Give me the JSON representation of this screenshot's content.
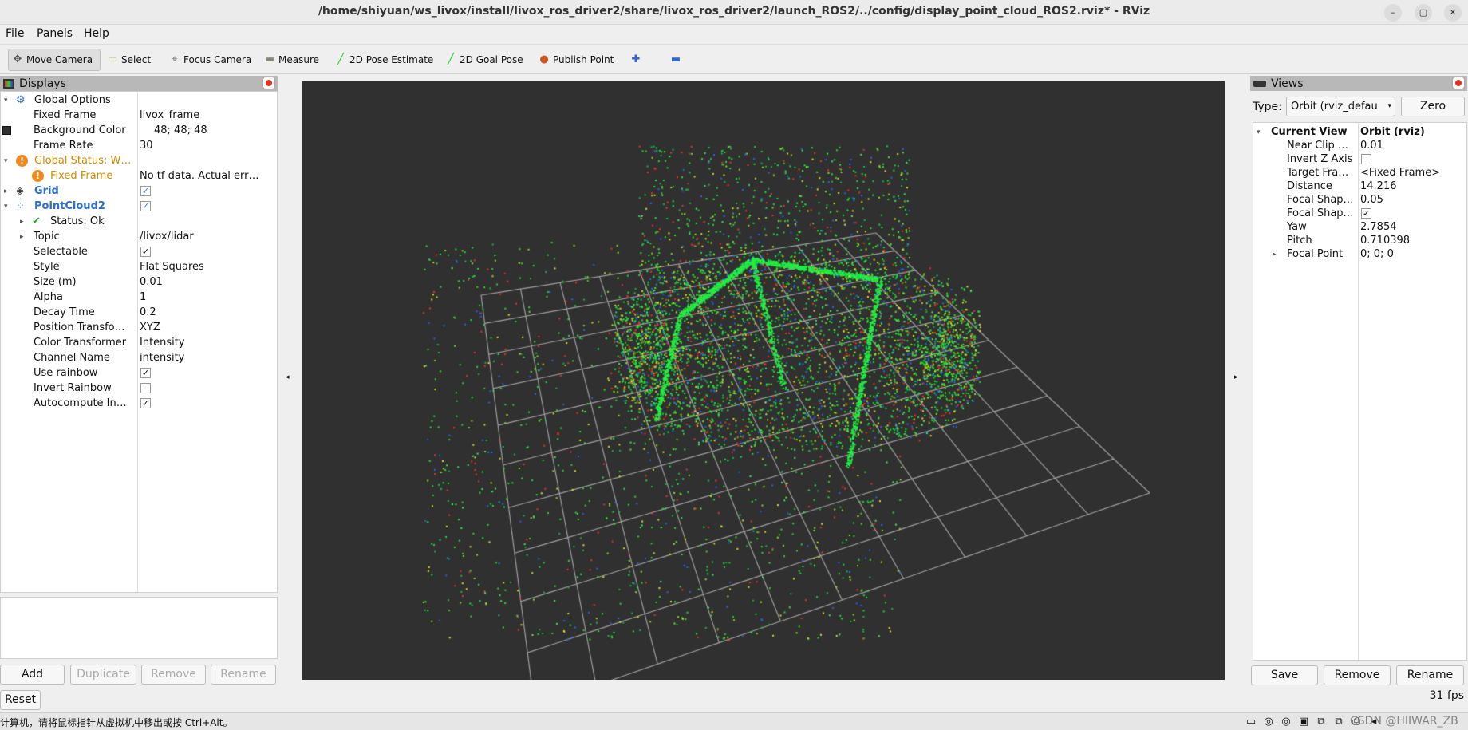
{
  "window": {
    "title": "/home/shiyuan/ws_livox/install/livox_ros_driver2/share/livox_ros_driver2/launch_ROS2/../config/display_point_cloud_ROS2.rviz* - RViz",
    "min": "–",
    "max": "▢",
    "close": "✕"
  },
  "menu": [
    "File",
    "Panels",
    "Help"
  ],
  "toolbar": [
    {
      "label": "Move Camera",
      "icon": "move-camera-icon",
      "glyph": "✥",
      "active": true
    },
    {
      "label": "Select",
      "icon": "select-icon",
      "glyph": "▭"
    },
    {
      "label": "Focus Camera",
      "icon": "focus-camera-icon",
      "glyph": "⌖"
    },
    {
      "label": "Measure",
      "icon": "ruler-icon",
      "glyph": "▬"
    },
    {
      "label": "2D Pose Estimate",
      "icon": "pose-arrow-icon",
      "glyph": "╱"
    },
    {
      "label": "2D Goal Pose",
      "icon": "goal-arrow-icon",
      "glyph": "╱"
    },
    {
      "label": "Publish Point",
      "icon": "map-pin-icon",
      "glyph": "●"
    },
    {
      "label": "",
      "icon": "plus-icon",
      "glyph": "✚"
    },
    {
      "label": "",
      "icon": "minus-icon",
      "glyph": "▬"
    }
  ],
  "displays": {
    "title": "Displays",
    "rows": [
      {
        "indent": 0,
        "exp": "▾",
        "icon": "gear-icon",
        "glyph": "⚙",
        "label": "Global Options",
        "value": ""
      },
      {
        "indent": 1,
        "label": "Fixed Frame",
        "value": "livox_frame"
      },
      {
        "indent": 1,
        "label": "Background Color",
        "value": "48; 48; 48",
        "swatch": "#303030"
      },
      {
        "indent": 1,
        "label": "Frame Rate",
        "value": "30"
      },
      {
        "indent": 0,
        "exp": "▾",
        "icon": "warning-icon",
        "glyph": "!",
        "label": "Global Status: W…",
        "value": "",
        "color": "#d08a00"
      },
      {
        "indent": 1,
        "icon": "warning-icon",
        "glyph": "!",
        "label": "Fixed Frame",
        "value": "No tf data.  Actual err…",
        "color": "#d08a00"
      },
      {
        "indent": 0,
        "exp": "▸",
        "icon": "grid-icon",
        "glyph": "◈",
        "label": "Grid",
        "check": true,
        "blue": true,
        "color": "#2a6fd0",
        "bold": true
      },
      {
        "indent": 0,
        "exp": "▾",
        "icon": "pointcloud-icon",
        "glyph": "⁘",
        "label": "PointCloud2",
        "check": true,
        "blue": true,
        "color": "#2a6fd0",
        "bold": true
      },
      {
        "indent": 1,
        "exp": "▸",
        "icon": "check-icon",
        "glyph": "✔",
        "label": "Status: Ok",
        "value": ""
      },
      {
        "indent": 1,
        "exp": "▸",
        "label": "Topic",
        "value": "/livox/lidar"
      },
      {
        "indent": 1,
        "label": "Selectable",
        "check": true
      },
      {
        "indent": 1,
        "label": "Style",
        "value": "Flat Squares"
      },
      {
        "indent": 1,
        "label": "Size (m)",
        "value": "0.01"
      },
      {
        "indent": 1,
        "label": "Alpha",
        "value": "1"
      },
      {
        "indent": 1,
        "label": "Decay Time",
        "value": "0.2"
      },
      {
        "indent": 1,
        "label": "Position Transfo…",
        "value": "XYZ"
      },
      {
        "indent": 1,
        "label": "Color Transformer",
        "value": "Intensity"
      },
      {
        "indent": 1,
        "label": "Channel Name",
        "value": "intensity"
      },
      {
        "indent": 1,
        "label": "Use rainbow",
        "check": true
      },
      {
        "indent": 1,
        "label": "Invert Rainbow",
        "check": false
      },
      {
        "indent": 1,
        "label": "Autocompute In…",
        "check": true
      }
    ],
    "buttons": {
      "add": "Add",
      "duplicate": "Duplicate",
      "remove": "Remove",
      "rename": "Rename",
      "reset": "Reset"
    }
  },
  "views": {
    "title": "Views",
    "type_label": "Type:",
    "type_value": "Orbit (rviz_defau",
    "zero": "Zero",
    "rows": [
      {
        "indent": 0,
        "exp": "▾",
        "label": "Current View",
        "value": "Orbit (rviz)",
        "bold": true
      },
      {
        "indent": 1,
        "label": "Near Clip …",
        "value": "0.01"
      },
      {
        "indent": 1,
        "label": "Invert Z Axis",
        "check": false
      },
      {
        "indent": 1,
        "label": "Target Fra…",
        "value": "<Fixed Frame>"
      },
      {
        "indent": 1,
        "label": "Distance",
        "value": "14.216"
      },
      {
        "indent": 1,
        "label": "Focal Shap…",
        "value": "0.05"
      },
      {
        "indent": 1,
        "label": "Focal Shap…",
        "check": true
      },
      {
        "indent": 1,
        "label": "Yaw",
        "value": "2.7854"
      },
      {
        "indent": 1,
        "label": "Pitch",
        "value": "0.710398"
      },
      {
        "indent": 1,
        "exp": "▸",
        "label": "Focal Point",
        "value": "0; 0; 0"
      }
    ],
    "buttons": {
      "save": "Save",
      "remove": "Remove",
      "rename": "Rename"
    },
    "fps": "31 fps"
  },
  "status": {
    "message": "计算机，请将鼠标指针从虚拟机中移出或按 Ctrl+Alt。",
    "watermark": "CSDN @HIIWAR_ZB"
  },
  "colors": {
    "background": "#303030",
    "grid": "#a0a0a0",
    "point_main": "#22dd33",
    "accent": "#2a6fd0",
    "warning": "#d08a00"
  }
}
